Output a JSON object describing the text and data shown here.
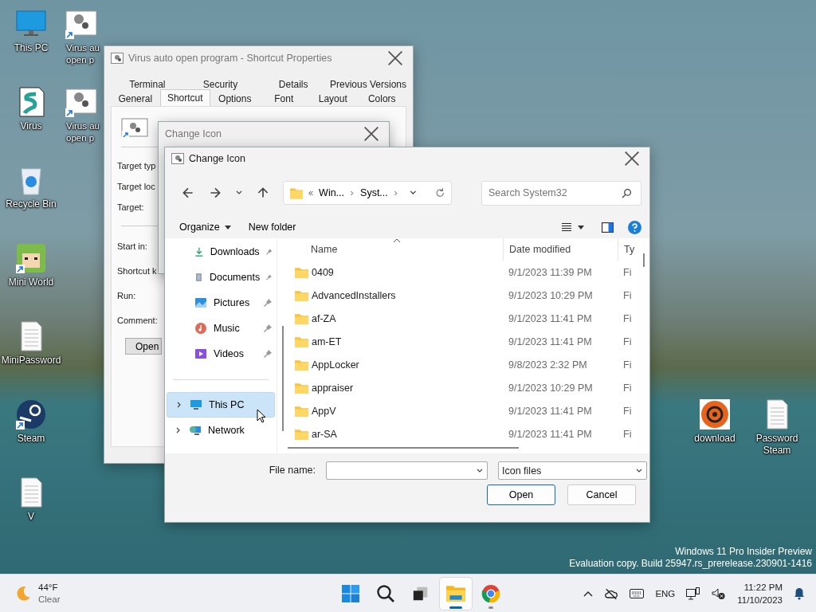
{
  "desktop": {
    "icons": [
      {
        "label": "This PC",
        "kind": "monitor",
        "shortcut": false
      },
      {
        "label": "Virus au open p",
        "kind": "gears",
        "shortcut": true
      },
      {
        "label": "Virus",
        "kind": "script",
        "shortcut": false
      },
      {
        "label": "Virus au open p",
        "kind": "gears",
        "shortcut": true
      },
      {
        "label": "Recycle Bin",
        "kind": "recycle",
        "shortcut": false
      },
      {
        "label": "Mini World",
        "kind": "game",
        "shortcut": true
      },
      {
        "label": "MiniPassword",
        "kind": "document",
        "shortcut": false
      },
      {
        "label": "Steam",
        "kind": "steam",
        "shortcut": true
      },
      {
        "label": "V",
        "kind": "document",
        "shortcut": false
      },
      {
        "label": "download",
        "kind": "biohazard",
        "shortcut": false
      },
      {
        "label": "Password Steam",
        "kind": "document",
        "shortcut": false
      }
    ],
    "build_info": [
      "Windows 11 Pro Insider Preview",
      "Evaluation copy. Build 25947.rs_prerelease.230901-1416"
    ]
  },
  "properties_window": {
    "title": "Virus auto open program - Shortcut Properties",
    "tab_rows": [
      [
        {
          "label": "Terminal",
          "selected": false
        },
        {
          "label": "Security",
          "selected": false
        },
        {
          "label": "Details",
          "selected": false
        },
        {
          "label": "Previous Versions",
          "selected": false
        }
      ],
      [
        {
          "label": "General",
          "selected": false
        },
        {
          "label": "Shortcut",
          "selected": true
        },
        {
          "label": "Options",
          "selected": false
        },
        {
          "label": "Font",
          "selected": false
        },
        {
          "label": "Layout",
          "selected": false
        },
        {
          "label": "Colors",
          "selected": false
        }
      ]
    ],
    "target_fields": [
      "Target typ",
      "Target loc",
      "Target:"
    ],
    "other_fields": [
      "Start in:",
      "Shortcut k",
      "Run:",
      "Comment:"
    ],
    "button": "Open"
  },
  "back_dialog": {
    "title": "Change Icon"
  },
  "dialog": {
    "title": "Change Icon",
    "address": {
      "segments": [
        "Win...",
        "Syst..."
      ]
    },
    "search": {
      "placeholder": "Search System32"
    },
    "commands": [
      "Organize",
      "New folder"
    ],
    "sidebar": [
      {
        "label": "Downloads",
        "kind": "download",
        "pinned": true,
        "selected": false
      },
      {
        "label": "Documents",
        "kind": "documents",
        "pinned": true,
        "selected": false
      },
      {
        "label": "Pictures",
        "kind": "pictures",
        "pinned": true,
        "selected": false
      },
      {
        "label": "Music",
        "kind": "music",
        "pinned": true,
        "selected": false
      },
      {
        "label": "Videos",
        "kind": "videos",
        "pinned": true,
        "selected": false
      },
      {
        "label": "This PC",
        "kind": "pc",
        "pinned": false,
        "selected": true
      },
      {
        "label": "Network",
        "kind": "network",
        "pinned": false,
        "selected": false
      }
    ],
    "columns": [
      "Name",
      "Date modified",
      "Ty"
    ],
    "rows": [
      [
        "0409",
        "9/1/2023 11:39 PM",
        "Fi"
      ],
      [
        "AdvancedInstallers",
        "9/1/2023 10:29 PM",
        "Fi"
      ],
      [
        "af-ZA",
        "9/1/2023 11:41 PM",
        "Fi"
      ],
      [
        "am-ET",
        "9/1/2023 11:41 PM",
        "Fi"
      ],
      [
        "AppLocker",
        "9/8/2023 2:32 PM",
        "Fi"
      ],
      [
        "appraiser",
        "9/1/2023 10:29 PM",
        "Fi"
      ],
      [
        "AppV",
        "9/1/2023 11:41 PM",
        "Fi"
      ],
      [
        "ar-SA",
        "9/1/2023 11:41 PM",
        "Fi"
      ]
    ],
    "file_name_label": "File name:",
    "file_type": "Icon files",
    "buttons": [
      {
        "label": "Open",
        "kind": "primary"
      },
      {
        "label": "Cancel",
        "kind": "secondary"
      }
    ]
  },
  "taskbar": {
    "weather": {
      "temperature": "44°F",
      "condition": "Clear"
    },
    "apps": [
      {
        "kind": "start",
        "open": false,
        "focused": false
      },
      {
        "kind": "search",
        "open": false,
        "focused": false
      },
      {
        "kind": "taskview",
        "open": false,
        "focused": false
      },
      {
        "kind": "explorer",
        "open": true,
        "focused": true
      },
      {
        "kind": "chrome",
        "open": true,
        "focused": false
      }
    ],
    "tray": {
      "language": "ENG",
      "time": "11:22 PM",
      "date": "11/10/2023"
    }
  }
}
